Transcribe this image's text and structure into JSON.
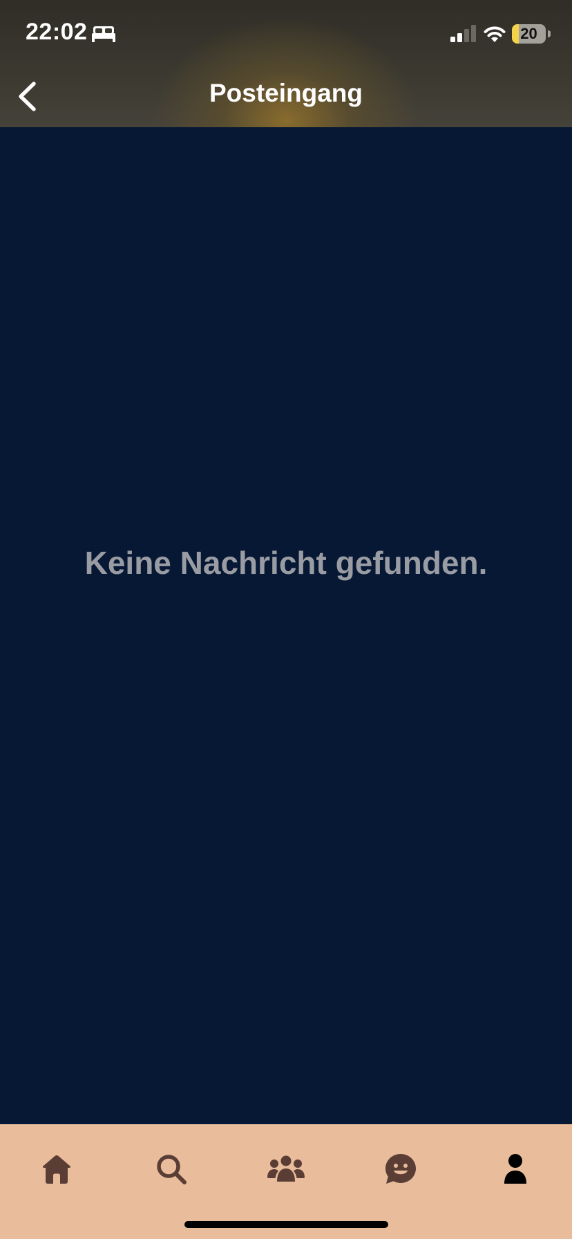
{
  "status_bar": {
    "time": "22:02",
    "battery_level": "20",
    "battery_fraction": 0.2,
    "icons": [
      "bed-icon",
      "cellular-signal-icon",
      "wifi-icon",
      "battery-icon"
    ]
  },
  "header": {
    "title": "Posteingang",
    "back_icon": "chevron-left-icon"
  },
  "main": {
    "empty_message": "Keine Nachricht gefunden."
  },
  "tab_bar": {
    "items": [
      {
        "icon": "home-icon",
        "active": false
      },
      {
        "icon": "search-icon",
        "active": false
      },
      {
        "icon": "community-icon",
        "active": false
      },
      {
        "icon": "chat-icon",
        "active": false
      },
      {
        "icon": "profile-icon",
        "active": true
      }
    ]
  },
  "colors": {
    "header_gradient_dark": "#2f2d26",
    "header_glow": "#8c6e2d",
    "main_background": "#071835",
    "empty_text": "#9a9ca3",
    "tab_bar_background": "#e9bc9b",
    "tab_icon_inactive": "#5a3e36",
    "tab_icon_active": "#000000",
    "battery_fill": "#f3d34a"
  }
}
